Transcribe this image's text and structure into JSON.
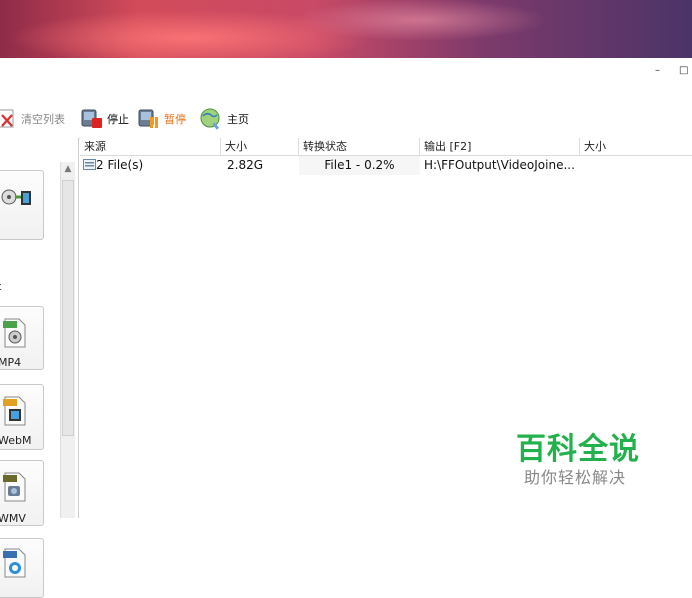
{
  "window": {
    "minimize_symbol": "–",
    "maximize_symbol": "□"
  },
  "toolbar": {
    "clear_list_label": "清空列表",
    "stop_label": "停止",
    "pause_label": "暂停",
    "home_label": "主页"
  },
  "sidebar": {
    "items": [
      {
        "label": "",
        "icon": "video-convert-icon"
      },
      {
        "label": "MP4",
        "icon": "mp4-file-icon"
      },
      {
        "label": "WebM",
        "icon": "webm-file-icon"
      },
      {
        "label": "WMV",
        "icon": "wmv-file-icon"
      },
      {
        "label": "",
        "icon": "mov-file-icon"
      }
    ],
    "first_label_fragment": "ε"
  },
  "table": {
    "columns": [
      "来源",
      "大小",
      "转换状态",
      "输出 [F2]",
      "大小"
    ],
    "rows": [
      {
        "source": "2 File(s)",
        "size": "2.82G",
        "status": "File1 - 0.2%",
        "output": "H:\\FFOutput\\VideoJoine...",
        "out_size": ""
      }
    ]
  },
  "watermark": {
    "title": "百科全说",
    "subtitle": "助你轻松解决"
  },
  "colors": {
    "accent_green": "#23b14d",
    "pause_orange": "#e8701a"
  }
}
